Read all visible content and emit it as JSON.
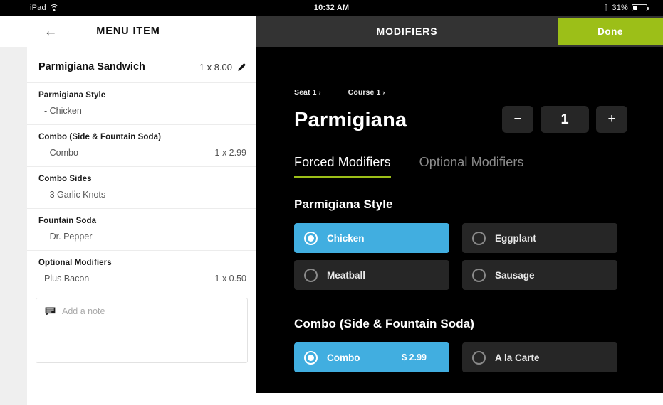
{
  "statusbar": {
    "device": "iPad",
    "wifi_icon": "wifi-icon",
    "time": "10:32 AM",
    "bluetooth_icon": "bluetooth-icon",
    "battery_percent": "31%",
    "battery_icon": "battery-icon"
  },
  "left_pane": {
    "back_icon": "back-arrow-icon",
    "title": "MENU ITEM",
    "item": {
      "name": "Parmigiana Sandwich",
      "price": "1 x 8.00",
      "edit_icon": "pencil-icon"
    },
    "groups": [
      {
        "title": "Parmigiana Style",
        "line": "- Chicken",
        "price": ""
      },
      {
        "title": "Combo (Side & Fountain Soda)",
        "line": "- Combo",
        "price": "1 x 2.99"
      },
      {
        "title": "Combo Sides",
        "line": "- 3 Garlic Knots",
        "price": ""
      },
      {
        "title": "Fountain Soda",
        "line": "- Dr. Pepper",
        "price": ""
      },
      {
        "title": "Optional Modifiers",
        "line": "Plus Bacon",
        "price": "1 x 0.50"
      }
    ],
    "note": {
      "icon": "note-bubble-icon",
      "placeholder": "Add a note",
      "value": ""
    }
  },
  "right_pane": {
    "title": "MODIFIERS",
    "done_label": "Done",
    "breadcrumbs": [
      {
        "label": "Seat 1",
        "chevron": "›"
      },
      {
        "label": "Course 1",
        "chevron": "›"
      }
    ],
    "dish_title": "Parmigiana",
    "stepper": {
      "minus": "−",
      "quantity": "1",
      "plus": "+"
    },
    "tabs": [
      {
        "label": "Forced Modifiers",
        "active": true
      },
      {
        "label": "Optional Modifiers",
        "active": false
      }
    ],
    "sections": [
      {
        "title": "Parmigiana Style",
        "options": [
          {
            "label": "Chicken",
            "price": "",
            "selected": true
          },
          {
            "label": "Eggplant",
            "price": "",
            "selected": false
          },
          {
            "label": "Meatball",
            "price": "",
            "selected": false
          },
          {
            "label": "Sausage",
            "price": "",
            "selected": false
          }
        ]
      },
      {
        "title": "Combo (Side & Fountain Soda)",
        "options": [
          {
            "label": "Combo",
            "price": "$ 2.99",
            "selected": true
          },
          {
            "label": "A la Carte",
            "price": "",
            "selected": false
          }
        ]
      }
    ]
  },
  "colors": {
    "accent_green": "#9cbf18",
    "accent_blue": "#41aee0",
    "panel_dark": "#262626",
    "header_dark": "#333333"
  }
}
